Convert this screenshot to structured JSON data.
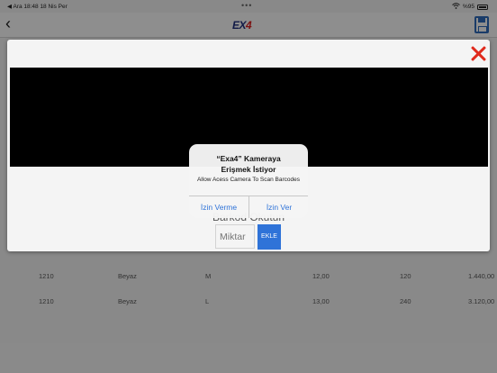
{
  "status_bar": {
    "left": "◀ Ara  18:48  18 Nis Per",
    "dots": "•••",
    "right_pct": "%95"
  },
  "nav": {
    "back": "‹",
    "logo_ex": "EX",
    "logo_4": "4"
  },
  "table": {
    "rows": [
      [
        "1210",
        "Beyaz",
        "M",
        "12,00",
        "120",
        "1.440,00"
      ],
      [
        "1210",
        "Beyaz",
        "L",
        "13,00",
        "240",
        "3.120,00"
      ]
    ]
  },
  "modal": {
    "hint": "Barkod Okutun",
    "quantity_placeholder": "Miktar",
    "add_label": "EKLE"
  },
  "alert": {
    "title_line1": "“Exa4” Kameraya",
    "title_line2": "Erişmek İstiyor",
    "message": "Allow Acess Camera To Scan Barcodes",
    "deny_label": "İzin Verme",
    "allow_label": "İzin Ver"
  },
  "colors": {
    "accent": "#2f73d8",
    "close": "#e02a1c",
    "logo_blue": "#1f2f7a",
    "logo_red": "#d62020"
  }
}
